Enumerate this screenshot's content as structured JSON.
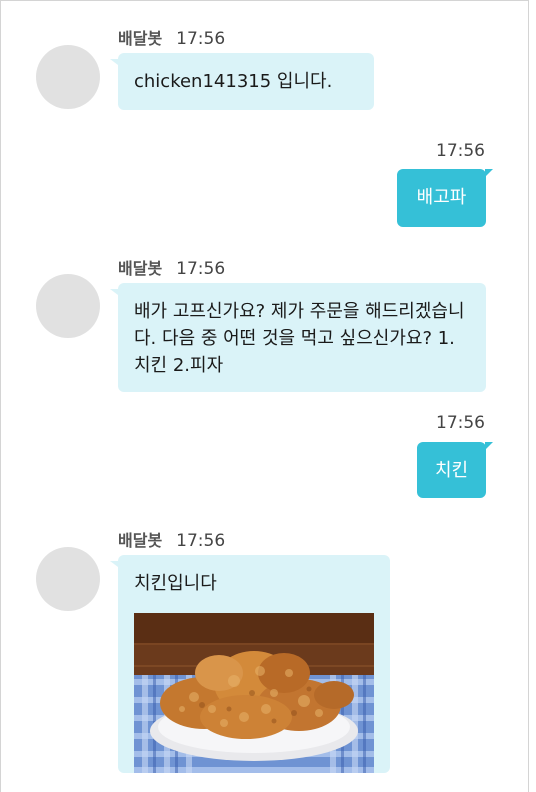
{
  "bot_name": "배달봇",
  "messages": [
    {
      "sender": "bot",
      "name": "배달봇",
      "time": "17:56",
      "text": "chicken141315 입니다."
    },
    {
      "sender": "me",
      "time": "17:56",
      "text": "배고파"
    },
    {
      "sender": "bot",
      "name": "배달봇",
      "time": "17:56",
      "text": "배가 고프신가요? 제가 주문을 해드리겠습니다. 다음 중 어떤 것을 먹고 싶으신가요? 1.치킨 2.피자"
    },
    {
      "sender": "me",
      "time": "17:56",
      "text": "치킨"
    },
    {
      "sender": "bot",
      "name": "배달봇",
      "time": "17:56",
      "text": "치킨입니다",
      "image": "fried-chicken-photo"
    }
  ],
  "colors": {
    "bot_bubble": "#daf3f8",
    "my_bubble": "#35c0d7",
    "avatar": "#e1e1e1"
  }
}
